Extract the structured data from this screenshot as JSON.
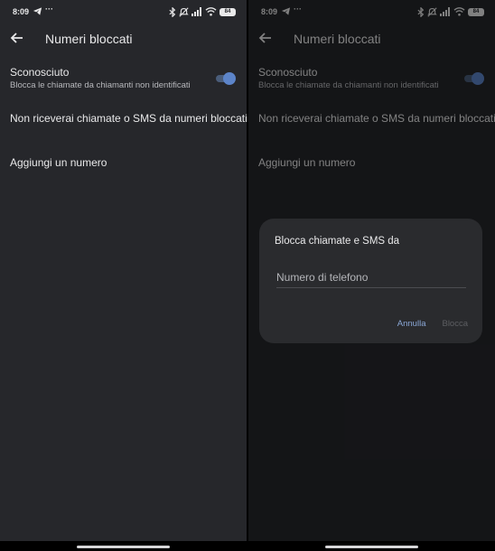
{
  "status_bar": {
    "time": "8:09",
    "more": "···",
    "battery": "84"
  },
  "appbar": {
    "title": "Numeri bloccati"
  },
  "unknown_setting": {
    "title": "Sconosciuto",
    "subtitle": "Blocca le chiamate da chiamanti non identificati",
    "enabled": true
  },
  "notice": "Non riceverai chiamate o SMS da numeri bloccati.",
  "add_number": "Aggiungi un numero",
  "dialog": {
    "title": "Blocca chiamate e SMS da",
    "input_placeholder": "Numero di telefono",
    "input_value": "",
    "cancel_label": "Annulla",
    "block_label": "Blocca"
  },
  "colors": {
    "background": "#26272b",
    "text": "#e9e9ea",
    "accent": "#5c84c9",
    "dialog_bg": "#2a2b2e"
  },
  "icons": [
    "telegram-icon",
    "bluetooth-icon",
    "mute-icon",
    "signal-icon",
    "wifi-icon",
    "battery-icon",
    "back-arrow-icon"
  ]
}
